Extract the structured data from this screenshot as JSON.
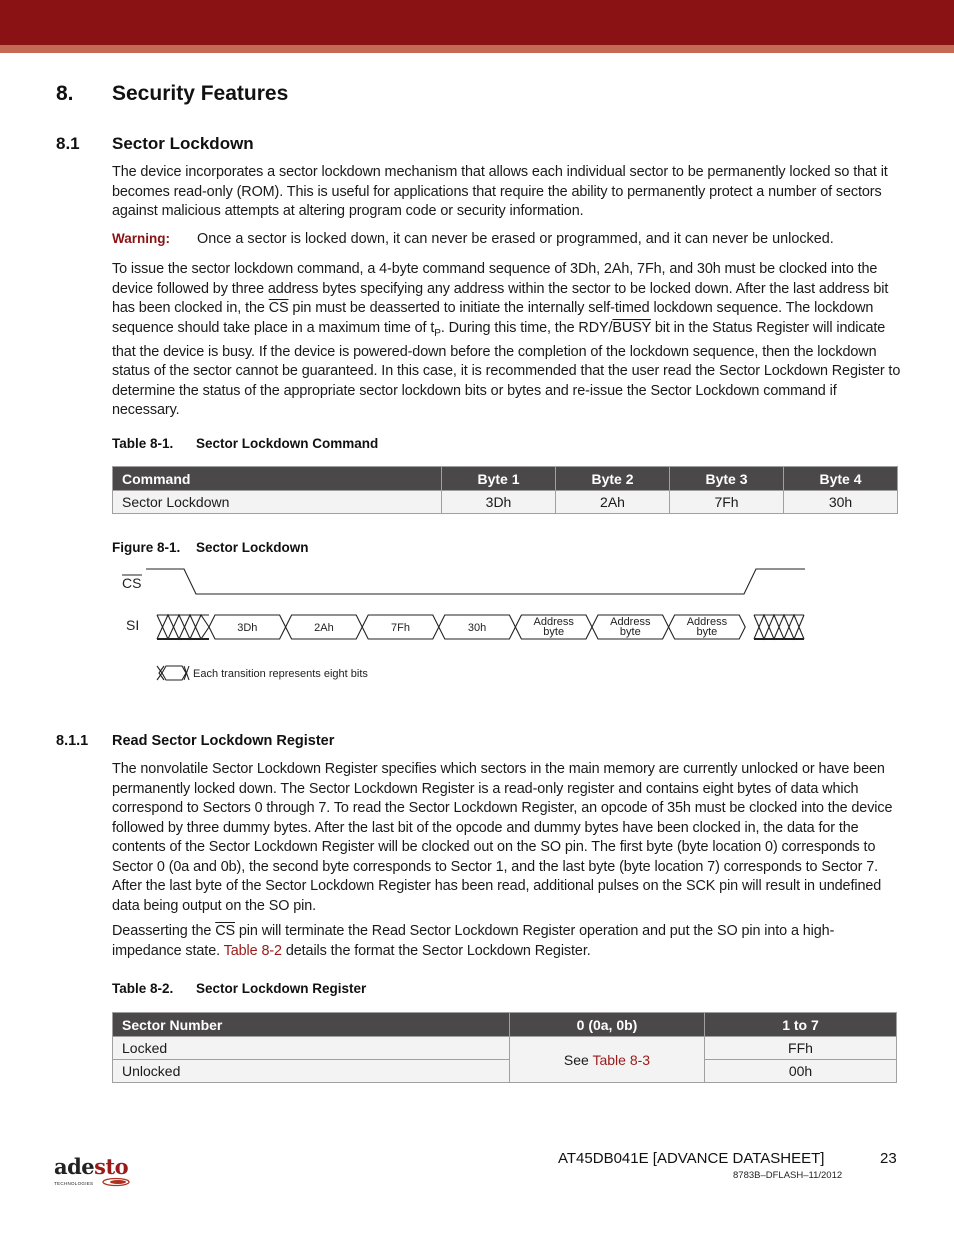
{
  "header": {
    "bar_color": "#8a1214",
    "stripe_color": "#c56a55"
  },
  "section": {
    "number": "8.",
    "title": "Security Features"
  },
  "subsection": {
    "number": "8.1",
    "title": "Sector Lockdown"
  },
  "intro_paragraph": "The device incorporates a sector lockdown mechanism that allows each individual sector to be permanently locked so that it becomes read-only (ROM). This is useful for applications that require the ability to permanently protect a number of sectors against malicious attempts at altering program code or security information.",
  "warning": {
    "label": "Warning:",
    "text": "Once a sector is locked down, it can never be erased or programmed, and it can never be unlocked."
  },
  "command_paragraph": {
    "part1": "To issue the sector lockdown command, a 4-byte command sequence of 3Dh, 2Ah, 7Fh, and 30h must be clocked into the device followed by three address bytes specifying any address within the sector to be locked down. After the last address bit has been clocked in, the ",
    "cs": "CS",
    "part2": " pin must be deasserted to initiate the internally self-timed lockdown sequence. The lockdown sequence should take place in a maximum time of t",
    "sub": "P",
    "part3": ". During this time, the RDY/",
    "busy": "BUSY",
    "part4": " bit in the Status Register will indicate that the device is busy. If the device is powered-down before the completion of the lockdown sequence, then the lockdown status of the sector cannot be guaranteed. In this case, it is recommended that the user read the Sector Lockdown Register to determine the status of the appropriate sector lockdown bits or bytes and re-issue the Sector Lockdown command if necessary."
  },
  "table1": {
    "caption_num": "Table 8-1.",
    "caption_title": "Sector Lockdown Command",
    "headers": [
      "Command",
      "Byte 1",
      "Byte 2",
      "Byte 3",
      "Byte 4"
    ],
    "rows": [
      [
        "Sector Lockdown",
        "3Dh",
        "2Ah",
        "7Fh",
        "30h"
      ]
    ]
  },
  "figure1": {
    "caption_num": "Figure 8-1.",
    "caption_title": "Sector Lockdown",
    "cs_label": "CS",
    "si_label": "SI",
    "bytes": [
      "3Dh",
      "2Ah",
      "7Fh",
      "30h"
    ],
    "address_line1": "Address",
    "address_line2": "byte",
    "legend": "Each transition represents eight bits"
  },
  "subsubsection": {
    "number": "8.1.1",
    "title": "Read Sector Lockdown Register"
  },
  "register_paragraph": "The nonvolatile Sector Lockdown Register specifies which sectors in the main memory are currently unlocked or have been permanently locked down. The Sector Lockdown Register is a read-only register and contains eight bytes of data which correspond to Sectors 0 through 7. To read the Sector Lockdown Register, an opcode of 35h must be clocked into the device followed by three dummy bytes. After the last bit of the opcode and dummy bytes have been clocked in, the data for the contents of the Sector Lockdown Register will be clocked out on the SO pin. The first byte (byte location 0) corresponds to Sector 0 (0a and 0b), the second byte corresponds to Sector 1, and the last byte (byte location 7) corresponds to Sector 7. After the last byte of the Sector Lockdown Register has been read, additional pulses on the SCK pin will result in undefined data being output on the SO pin.",
  "deassert_paragraph": {
    "part1": "Deasserting the ",
    "cs": "CS",
    "part2": " pin will terminate the Read Sector Lockdown Register operation and put the SO pin into a high-impedance state. ",
    "link": "Table 8-2",
    "part3": " details the format the Sector Lockdown Register."
  },
  "table2": {
    "caption_num": "Table 8-2.",
    "caption_title": "Sector Lockdown Register",
    "headers": [
      "Sector Number",
      "0 (0a, 0b)",
      "1 to 7"
    ],
    "row_locked": {
      "label": "Locked",
      "value": "FFh"
    },
    "row_unlocked": {
      "label": "Unlocked",
      "value": "00h"
    },
    "merged_prefix": "See ",
    "merged_link": "Table 8-3"
  },
  "footer": {
    "logo_part1": "ade",
    "logo_part2": "sto",
    "logo_tagline": "TECHNOLOGIES",
    "doc_title": "AT45DB041E [ADVANCE DATASHEET]",
    "page_number": "23",
    "doc_code": "8783B–DFLASH–11/2012"
  }
}
